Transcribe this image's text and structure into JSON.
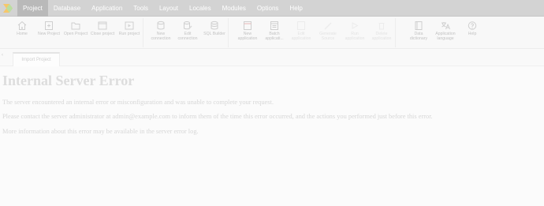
{
  "menu": {
    "items": [
      "Project",
      "Database",
      "Application",
      "Tools",
      "Layout",
      "Locales",
      "Modules",
      "Options",
      "Help"
    ],
    "active": "Project"
  },
  "toolbar": {
    "home": "Home",
    "new_project": "New Project",
    "open_project": "Open Project",
    "close_project": "Close project",
    "run_project": "Run project",
    "new_connection": "New connection",
    "edit_connection": "Edit connection",
    "sql_builder": "SQL Builder",
    "new_application": "New application",
    "batch_application": "Batch applicati...",
    "disabled_1": "Edit application",
    "disabled_2": "Generate Source",
    "disabled_3": "Run application",
    "disabled_4": "Delete application",
    "data_dictionary": "Data dictionary",
    "application_language": "Application language",
    "help": "Help"
  },
  "tabs": {
    "arrow": "‹",
    "active_label": "Import Project"
  },
  "error": {
    "title": "Internal Server Error",
    "line1": "The server encountered an internal error or misconfiguration and was unable to complete your request.",
    "line2": "Please contact the server administrator at admin@example.com to inform them of the time this error occurred, and the actions you performed just before this error.",
    "line3": "More information about this error may be available in the server error log."
  },
  "colors": {
    "menubar_bg": "#d3d3d3",
    "logo_orange": "#f6c76a",
    "logo_green": "#b9dfa1"
  }
}
